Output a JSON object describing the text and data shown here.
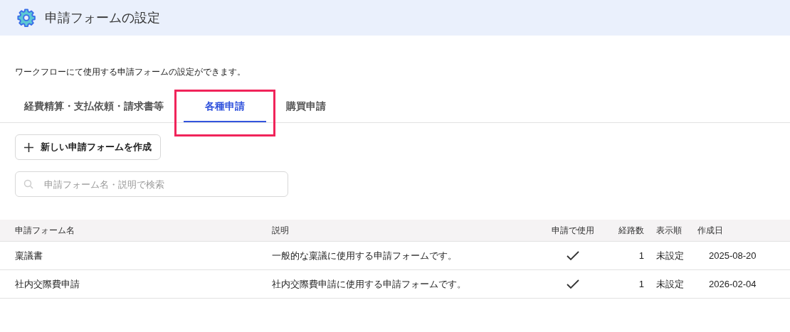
{
  "header": {
    "title": "申請フォームの設定"
  },
  "description": "ワークフローにて使用する申請フォームの設定ができます。",
  "tabs": [
    {
      "label": "経費精算・支払依頼・請求書等",
      "selected": false,
      "highlighted": false
    },
    {
      "label": "各種申請",
      "selected": true,
      "highlighted": true
    },
    {
      "label": "購買申請",
      "selected": false,
      "highlighted": false
    }
  ],
  "create_button": {
    "label": "新しい申請フォームを作成"
  },
  "search": {
    "placeholder": "申請フォーム名・説明で検索"
  },
  "table": {
    "columns": [
      "申請フォーム名",
      "説明",
      "申請で使用",
      "経路数",
      "表示順",
      "作成日"
    ],
    "rows": [
      {
        "name": "稟議書",
        "description": "一般的な稟議に使用する申請フォームです。",
        "used": true,
        "routes": "1",
        "order": "未設定",
        "created": "2025-08-20"
      },
      {
        "name": "社内交際費申請",
        "description": "社内交際費申請に使用する申請フォームです。",
        "used": true,
        "routes": "1",
        "order": "未設定",
        "created": "2026-02-04"
      }
    ]
  }
}
